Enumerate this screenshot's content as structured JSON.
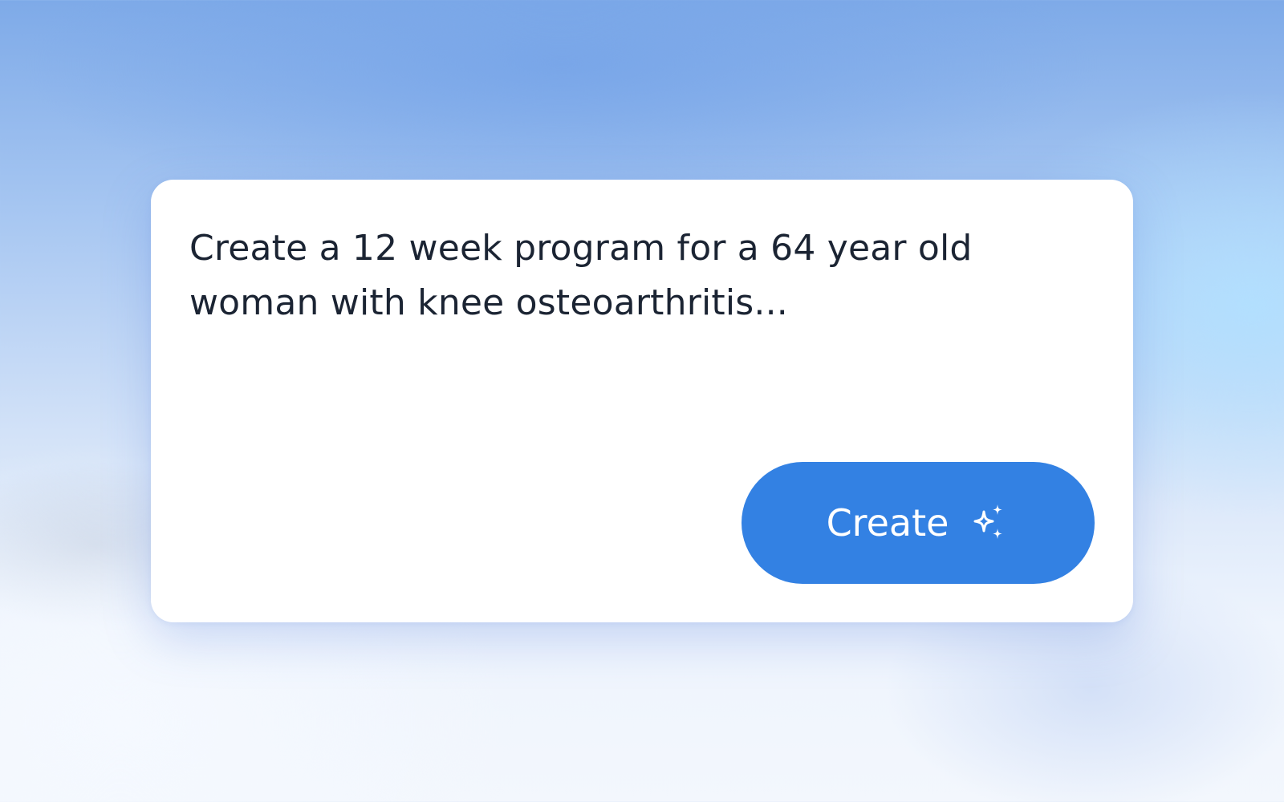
{
  "prompt": {
    "text": "Create a 12 week program for a 64 year old woman with knee osteoarthritis..."
  },
  "create_button": {
    "label": "Create",
    "icon": "sparkle-icon"
  },
  "colors": {
    "accent": "#3381e3",
    "text": "#1b2433",
    "card_background": "#ffffff"
  }
}
